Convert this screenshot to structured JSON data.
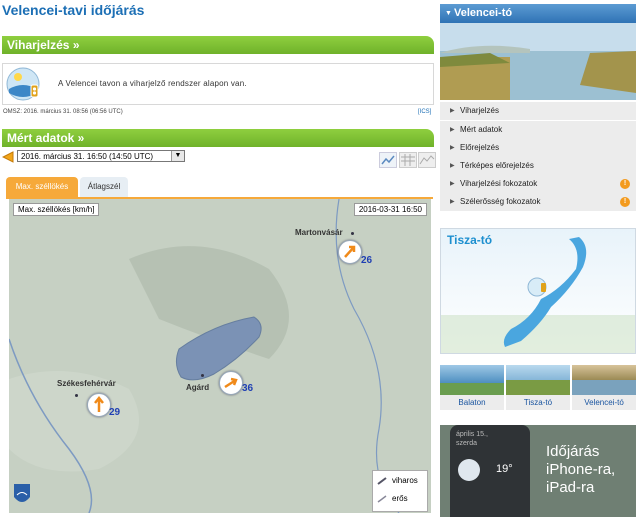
{
  "page_title": "Velencei-tavi időjárás",
  "storm_section": {
    "header": "Viharjelzés »",
    "warning_text": "A Velencei tavon a viharjelző rendszer alapon van.",
    "source_line": "OMSZ: 2016. március 31. 08:56 (06:56  UTC)",
    "icon_link": "[ICS]"
  },
  "measured_section": {
    "header": "Mért adatok »",
    "time_select": "2016. március 31. 16:50 (14:50  UTC)",
    "tabs": [
      {
        "label": "Max. széllökés",
        "active": true
      },
      {
        "label": "Átlagszél",
        "active": false
      }
    ]
  },
  "map": {
    "parameter_label": "Max. széllökés [km/h]",
    "timestamp": "2016-03-31 16:50",
    "stations": [
      {
        "name": "Martonvásár",
        "value": "26"
      },
      {
        "name": "Agárd",
        "value": "36"
      },
      {
        "name": "Székesfehérvár",
        "value": "29"
      }
    ],
    "legend": {
      "storm": "viharos",
      "strong": "erős"
    },
    "logo": "OMSZ"
  },
  "sidebar": {
    "header": "Velencei-tó",
    "menu": [
      {
        "label": "Viharjelzés"
      },
      {
        "label": "Mért adatok"
      },
      {
        "label": "Előrejelzés"
      },
      {
        "label": "Térképes előrejelzés"
      },
      {
        "label": "Viharjelzési fokozatok",
        "badge": "!"
      },
      {
        "label": "Szélerősség fokozatok",
        "badge": "!"
      }
    ],
    "tisza_title": "Tisza-tó",
    "thumbnails": [
      "Balaton",
      "Tisza-tó",
      "Velencei-tó"
    ],
    "ad": {
      "line1": "Időjárás",
      "line2": "iPhone-ra,",
      "line3": "iPad-ra",
      "date": "április 15.,",
      "day": "szerda",
      "temp": "19°"
    }
  },
  "colors": {
    "accent_green": "#7cc233",
    "link_blue": "#1c6fb5",
    "badge_orange": "#f39a1d"
  }
}
